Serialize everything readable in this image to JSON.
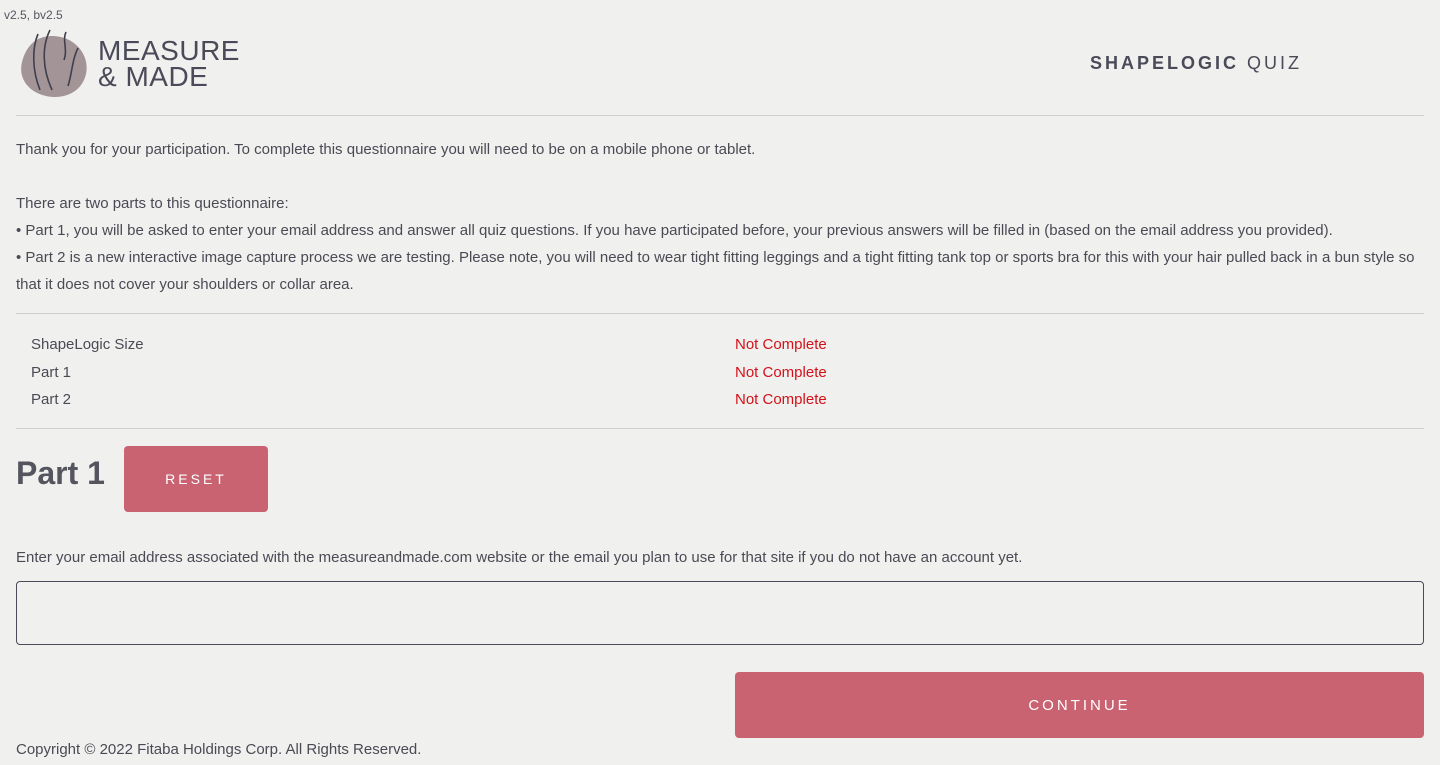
{
  "version": "v2.5, bv2.5",
  "header": {
    "logo_line1": "MEASURE",
    "logo_line2": "& MADE",
    "quiz_title_bold": "SHAPELOGIC",
    "quiz_title_light": "QUIZ"
  },
  "intro": {
    "line1": "Thank you for your participation. To complete this questionnaire you will need to be on a mobile phone or tablet.",
    "line2": "There are two parts to this questionnaire:",
    "bullet1": "• Part 1, you will be asked to enter your email address and answer all quiz questions. If you have participated before, your previous answers will be filled in (based on the email address you provided).",
    "bullet2": "• Part 2 is a new interactive image capture process we are testing. Please note, you will need to wear tight fitting leggings and a tight fitting tank top or sports bra for this with your hair pulled back in a bun style so that it does not cover your shoulders or collar area."
  },
  "status": [
    {
      "label": "ShapeLogic Size",
      "value": "Not Complete"
    },
    {
      "label": "Part 1",
      "value": "Not Complete"
    },
    {
      "label": "Part 2",
      "value": "Not Complete"
    }
  ],
  "part": {
    "heading": "Part 1",
    "reset_label": "RESET"
  },
  "email": {
    "label": "Enter your email address associated with the measureandmade.com website or the email you plan to use for that site if you do not have an account yet.",
    "value": "",
    "placeholder": ""
  },
  "continue_label": "CONTINUE",
  "copyright": "Copyright © 2022 Fitaba Holdings Corp. All Rights Reserved.",
  "colors": {
    "accent": "#c96372",
    "status_incomplete": "#d4111a",
    "background": "#f0f0ee",
    "text": "#4a4a55"
  }
}
